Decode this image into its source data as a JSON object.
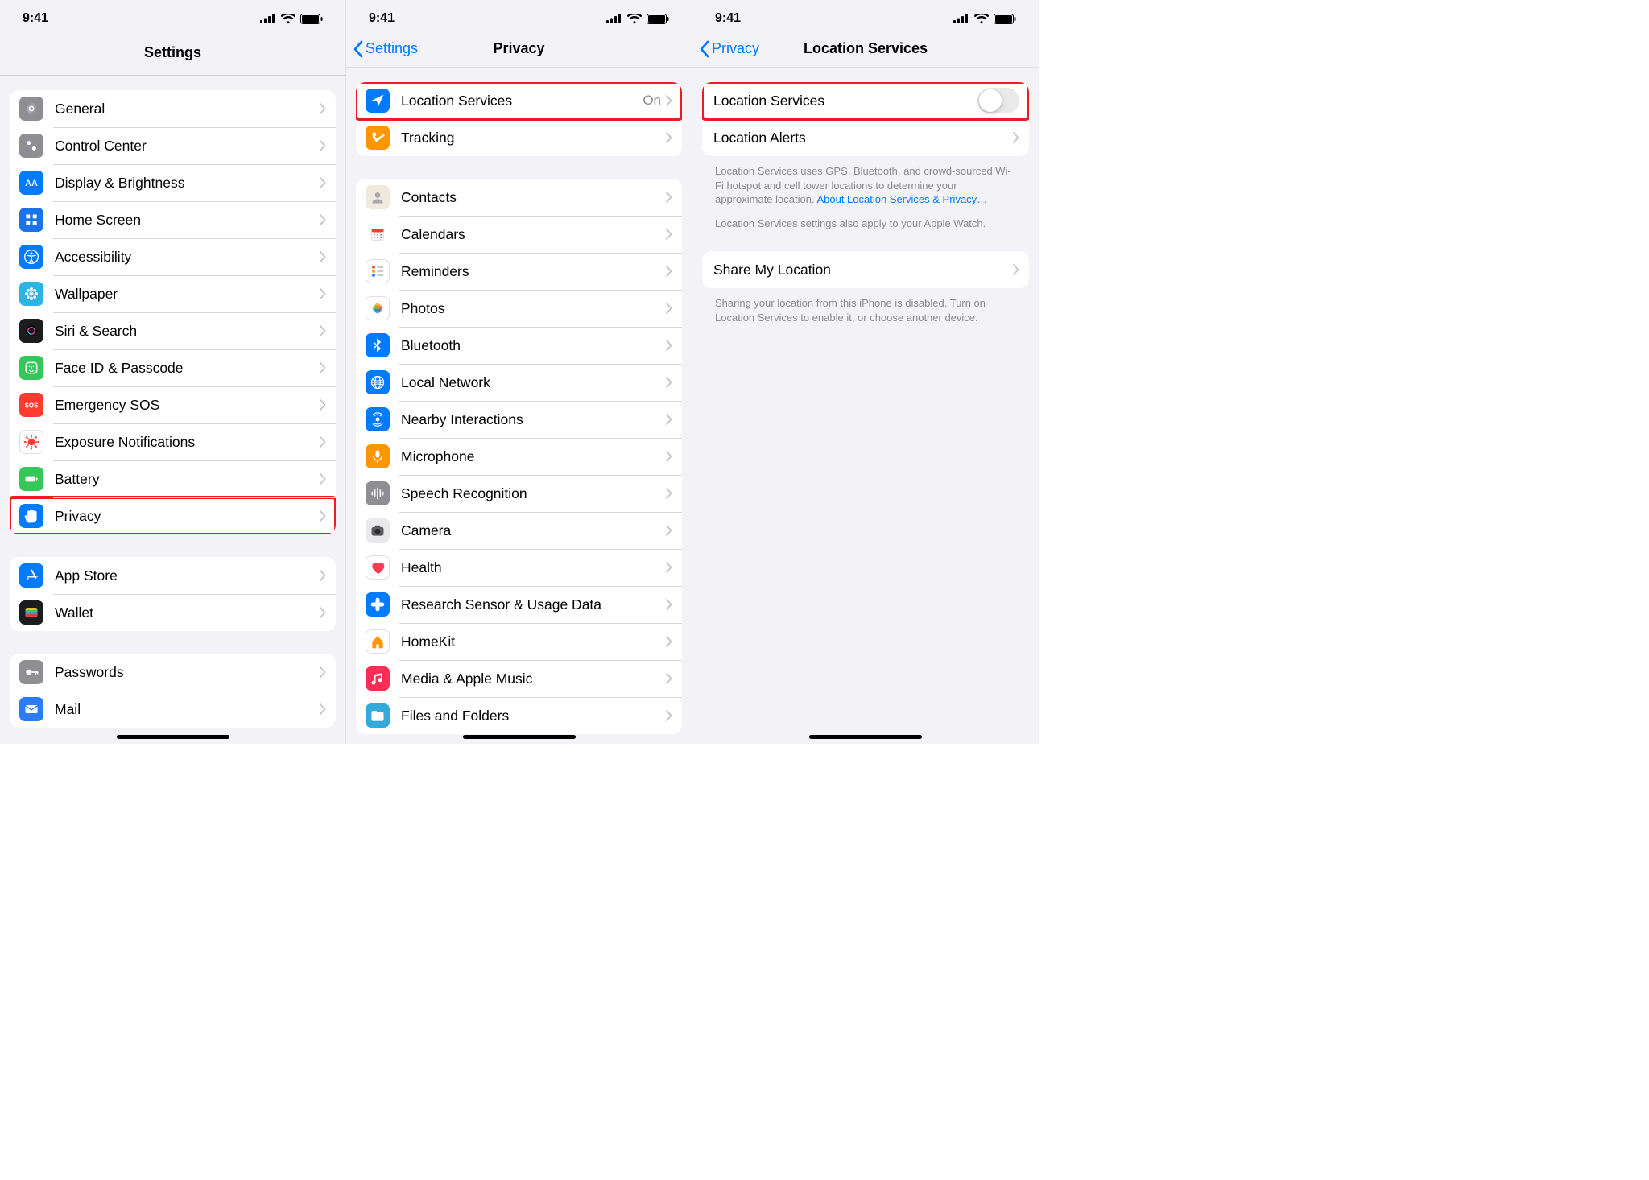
{
  "status_time": "9:41",
  "screen_settings": {
    "title": "Settings",
    "groups": [
      {
        "rows": [
          {
            "label": "General"
          },
          {
            "label": "Control Center"
          },
          {
            "label": "Display & Brightness"
          },
          {
            "label": "Home Screen"
          },
          {
            "label": "Accessibility"
          },
          {
            "label": "Wallpaper"
          },
          {
            "label": "Siri & Search"
          },
          {
            "label": "Face ID & Passcode"
          },
          {
            "label": "Emergency SOS"
          },
          {
            "label": "Exposure Notifications"
          },
          {
            "label": "Battery"
          },
          {
            "label": "Privacy",
            "highlighted": true
          }
        ]
      },
      {
        "rows": [
          {
            "label": "App Store"
          },
          {
            "label": "Wallet"
          }
        ]
      },
      {
        "rows": [
          {
            "label": "Passwords"
          },
          {
            "label": "Mail"
          }
        ]
      }
    ]
  },
  "screen_privacy": {
    "back_label": "Settings",
    "title": "Privacy",
    "groups": [
      {
        "rows": [
          {
            "label": "Location Services",
            "detail": "On",
            "highlighted": true
          },
          {
            "label": "Tracking"
          }
        ]
      },
      {
        "rows": [
          {
            "label": "Contacts"
          },
          {
            "label": "Calendars"
          },
          {
            "label": "Reminders"
          },
          {
            "label": "Photos"
          },
          {
            "label": "Bluetooth"
          },
          {
            "label": "Local Network"
          },
          {
            "label": "Nearby Interactions"
          },
          {
            "label": "Microphone"
          },
          {
            "label": "Speech Recognition"
          },
          {
            "label": "Camera"
          },
          {
            "label": "Health"
          },
          {
            "label": "Research Sensor & Usage Data"
          },
          {
            "label": "HomeKit"
          },
          {
            "label": "Media & Apple Music"
          },
          {
            "label": "Files and Folders"
          }
        ]
      }
    ]
  },
  "screen_location": {
    "back_label": "Privacy",
    "title": "Location Services",
    "toggle_row_label": "Location Services",
    "toggle_on": false,
    "alerts_row_label": "Location Alerts",
    "footnote1_a": "Location Services uses GPS, Bluetooth, and crowd-sourced Wi-Fi hotspot and cell tower locations to determine your approximate location. ",
    "footnote1_link": "About Location Services & Privacy…",
    "footnote1_b": "Location Services settings also apply to your Apple Watch.",
    "share_row_label": "Share My Location",
    "footnote2": "Sharing your location from this iPhone is disabled. Turn on Location Services to enable it, or choose another device."
  }
}
